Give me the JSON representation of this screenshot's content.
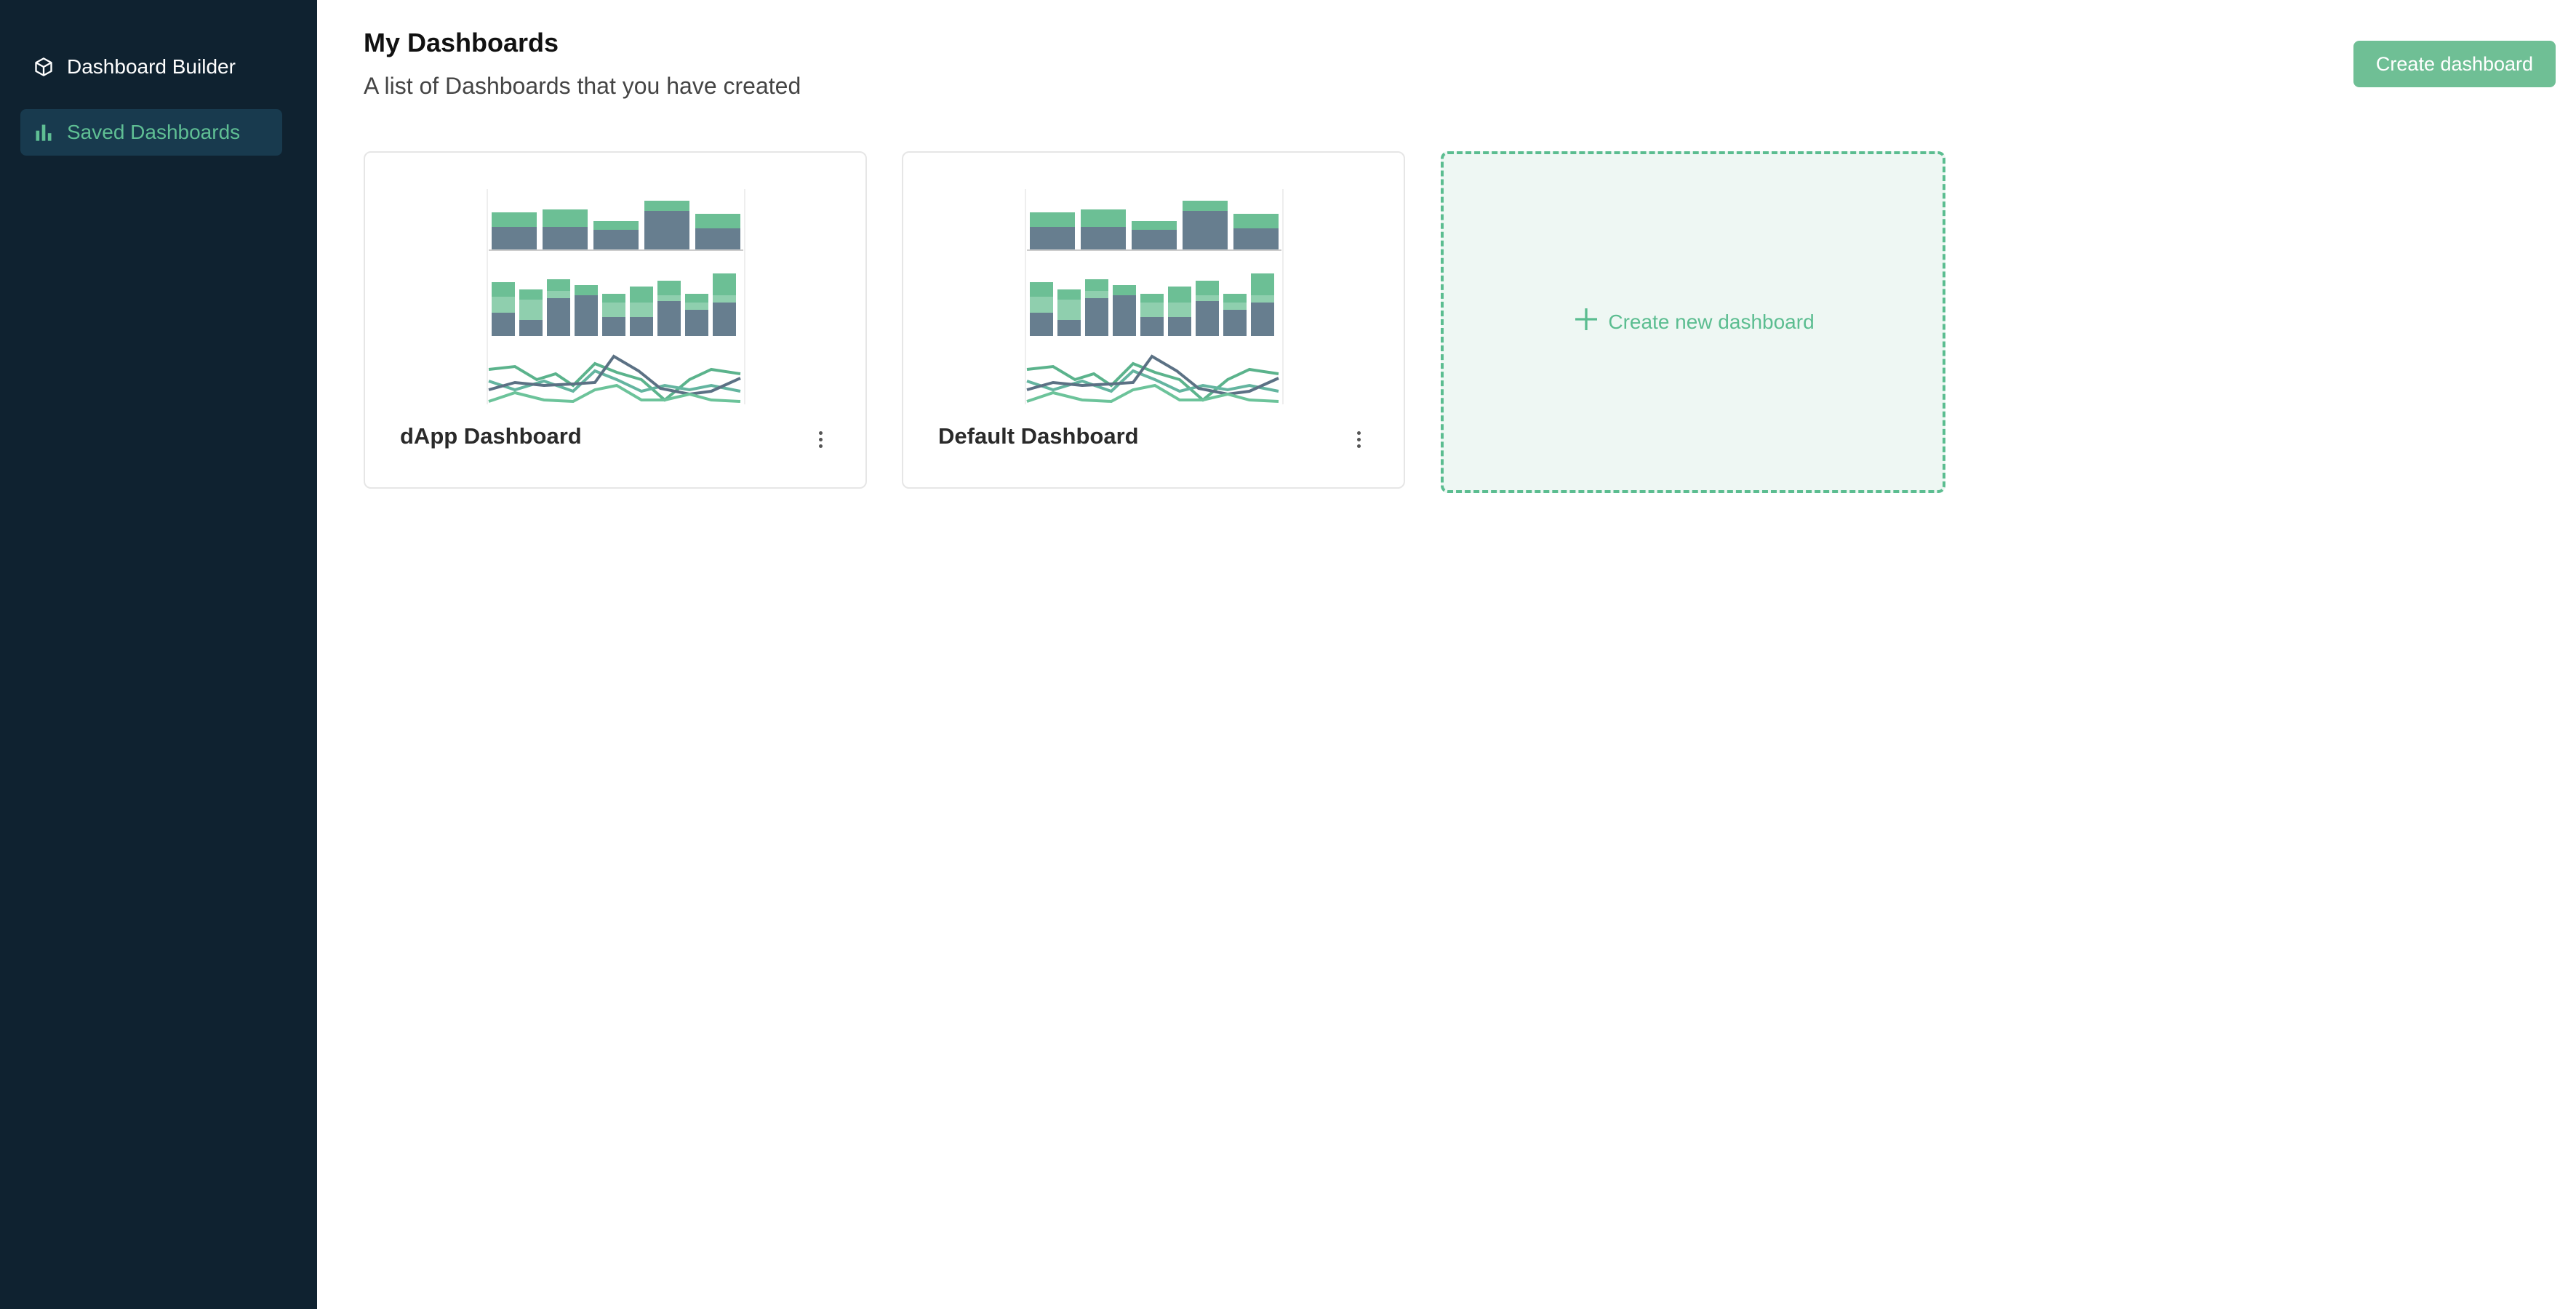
{
  "sidebar": {
    "items": [
      {
        "label": "Dashboard Builder",
        "icon": "cube-icon",
        "active": false
      },
      {
        "label": "Saved Dashboards",
        "icon": "bar-chart-icon",
        "active": true
      }
    ]
  },
  "header": {
    "title": "My Dashboards",
    "subtitle": "A list of Dashboards that you have created",
    "create_button_label": "Create dashboard"
  },
  "dashboards": [
    {
      "title": "dApp Dashboard"
    },
    {
      "title": "Default Dashboard"
    }
  ],
  "new_card": {
    "label": "Create new dashboard",
    "icon": "plus-icon"
  },
  "colors": {
    "sidebar_bg": "#0f2230",
    "accent": "#5bbd90",
    "active_bg": "#183a4e",
    "slate": "#5f7a8c"
  }
}
